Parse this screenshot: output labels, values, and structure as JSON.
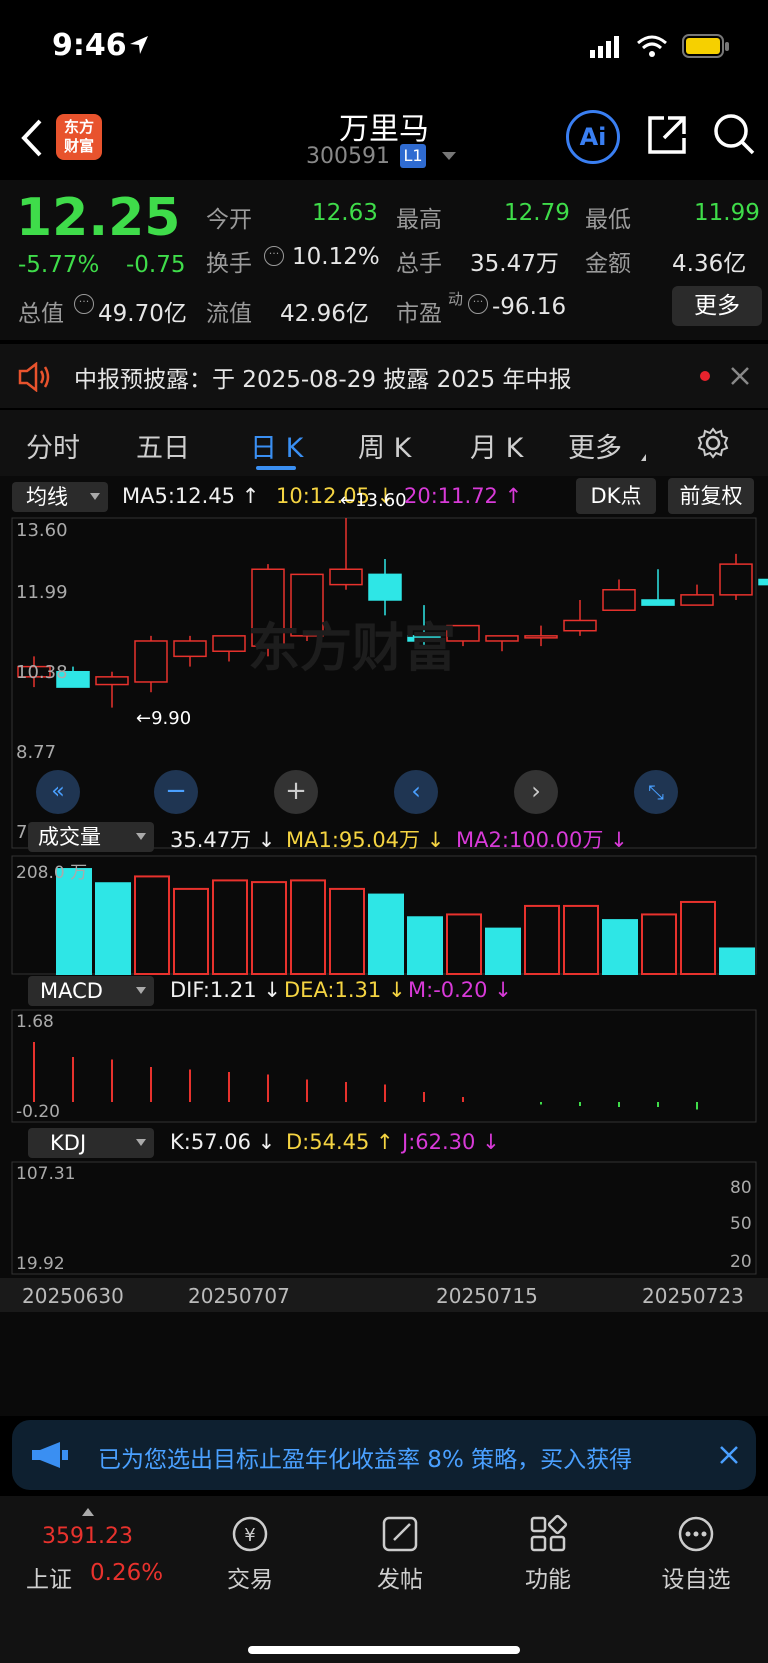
{
  "status": {
    "time": "9:46"
  },
  "header": {
    "logo": "东方\n财富",
    "title": "万里马",
    "code": "300591",
    "level": "L1"
  },
  "quote": {
    "price": "12.25",
    "pct": "-5.77%",
    "chg": "-0.75",
    "open_l": "今开",
    "open": "12.63",
    "high_l": "最高",
    "high": "12.79",
    "low_l": "最低",
    "low": "11.99",
    "turn_l": "换手",
    "turn": "10.12%",
    "vol_l": "总手",
    "vol": "35.47万",
    "amt_l": "金额",
    "amt": "4.36亿",
    "mcap_l": "总值",
    "mcap": "49.70亿",
    "fcap_l": "流值",
    "fcap": "42.96亿",
    "pe_l": "市盈",
    "pe_sup": "动",
    "pe": "-96.16",
    "more": "更多"
  },
  "notice": {
    "text": "中报预披露：于 2025-08-29 披露 2025 年中报"
  },
  "tabs": [
    "分时",
    "五日",
    "日 K",
    "周 K",
    "月 K",
    "更多"
  ],
  "chart": {
    "ma_selector": "均线",
    "ma5": "MA5:12.45 ↑",
    "ma10": "10:12.05 ↓",
    "ma20": "20:11.72 ↑",
    "dk": "DK点",
    "fq": "前复权",
    "y_ticks": [
      "13.60",
      "11.99",
      "10.38",
      "8.77",
      "7.16"
    ],
    "high_label": "←13.60",
    "low_label": "←9.90",
    "watermark": "东方财富",
    "vol_selector": "成交量",
    "vol_val": "35.47万 ↓",
    "vol_ma1": "MA1:95.04万 ↓",
    "vol_ma2": "MA2:100.00万 ↓",
    "vol_max": "208.0 万",
    "macd_selector": "MACD",
    "dif": "DIF:1.21 ↓",
    "dea": "DEA:1.31 ↓",
    "m": "M:-0.20 ↓",
    "macd_top": "1.68",
    "macd_bot": "-0.20",
    "kdj_selector": "KDJ",
    "k": "K:57.06 ↓",
    "d": "D:54.45 ↑",
    "j": "J:62.30 ↓",
    "kdj_top": "107.31",
    "kdj_bot": "19.92",
    "kdj_levels": [
      "80",
      "50",
      "20"
    ],
    "dates": [
      "20250630",
      "20250707",
      "20250715",
      "20250723"
    ]
  },
  "chart_data": {
    "type": "candlestick",
    "candles": [
      {
        "o": 10.5,
        "h": 10.9,
        "l": 10.3,
        "c": 10.7
      },
      {
        "o": 10.6,
        "h": 10.7,
        "l": 10.3,
        "c": 10.3
      },
      {
        "o": 10.35,
        "h": 10.6,
        "l": 9.9,
        "c": 10.5
      },
      {
        "o": 10.4,
        "h": 11.3,
        "l": 10.2,
        "c": 11.2
      },
      {
        "o": 10.9,
        "h": 11.3,
        "l": 10.7,
        "c": 11.2
      },
      {
        "o": 11.0,
        "h": 11.3,
        "l": 10.8,
        "c": 11.3
      },
      {
        "o": 11.1,
        "h": 12.7,
        "l": 10.9,
        "c": 12.6
      },
      {
        "o": 11.3,
        "h": 12.5,
        "l": 11.2,
        "c": 12.5
      },
      {
        "o": 12.3,
        "h": 13.6,
        "l": 12.2,
        "c": 12.6
      },
      {
        "o": 12.5,
        "h": 12.8,
        "l": 11.7,
        "c": 12.0
      },
      {
        "o": 11.3,
        "h": 11.9,
        "l": 11.1,
        "c": 11.2
      },
      {
        "o": 11.2,
        "h": 11.5,
        "l": 11.1,
        "c": 11.5
      },
      {
        "o": 11.2,
        "h": 11.3,
        "l": 11.0,
        "c": 11.3
      },
      {
        "o": 11.3,
        "h": 11.5,
        "l": 11.1,
        "c": 11.3
      },
      {
        "o": 11.4,
        "h": 12.0,
        "l": 11.3,
        "c": 11.6
      },
      {
        "o": 11.8,
        "h": 12.4,
        "l": 11.8,
        "c": 12.2
      },
      {
        "o": 12.0,
        "h": 12.6,
        "l": 11.9,
        "c": 11.9
      },
      {
        "o": 11.9,
        "h": 12.3,
        "l": 11.9,
        "c": 12.1
      },
      {
        "o": 12.1,
        "h": 12.9,
        "l": 12.0,
        "c": 12.7
      },
      {
        "o": 12.4,
        "h": 12.8,
        "l": 12.0,
        "c": 12.3
      }
    ],
    "volume_wan": [
      null,
      185,
      160,
      172,
      150,
      165,
      162,
      165,
      150,
      140,
      100,
      105,
      80,
      120,
      120,
      95,
      105,
      127,
      45
    ],
    "volume_up": [
      false,
      false,
      true,
      true,
      true,
      true,
      true,
      true,
      false,
      false,
      true,
      false,
      true,
      true,
      false,
      true,
      true,
      false
    ],
    "ylim": [
      7.16,
      13.6
    ],
    "macd_hist": [
      1.2,
      0.9,
      0.85,
      0.7,
      0.65,
      0.6,
      0.55,
      0.45,
      0.4,
      0.35,
      0.2,
      0.1,
      0.0,
      -0.05,
      -0.08,
      -0.1,
      -0.1,
      -0.15
    ]
  },
  "banner": {
    "text": "已为您选出目标止盈年化收益率 8% 策略，买入获得"
  },
  "bottom": {
    "index_val": "3591.23",
    "index_name": "上证",
    "index_pct": "0.26%",
    "trade": "交易",
    "post": "发帖",
    "func": "功能",
    "watch": "设自选"
  }
}
